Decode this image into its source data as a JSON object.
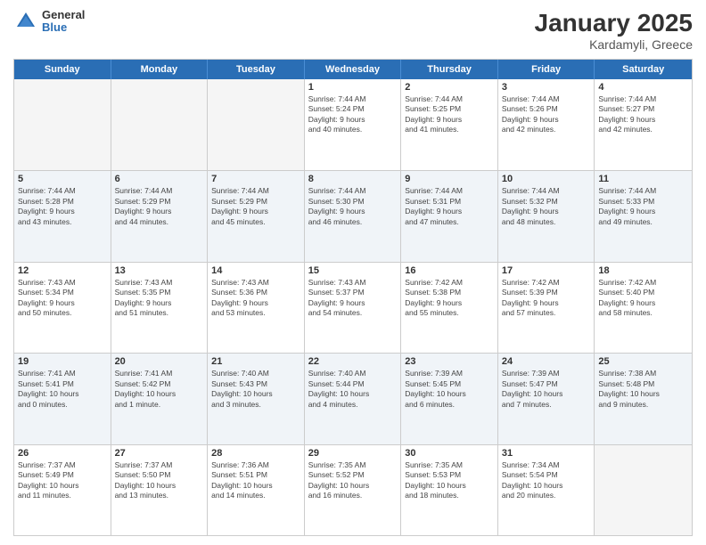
{
  "logo": {
    "general": "General",
    "blue": "Blue"
  },
  "title": "January 2025",
  "location": "Kardamyli, Greece",
  "header_days": [
    "Sunday",
    "Monday",
    "Tuesday",
    "Wednesday",
    "Thursday",
    "Friday",
    "Saturday"
  ],
  "weeks": [
    {
      "alt": false,
      "days": [
        {
          "num": "",
          "empty": true,
          "lines": []
        },
        {
          "num": "",
          "empty": true,
          "lines": []
        },
        {
          "num": "",
          "empty": true,
          "lines": []
        },
        {
          "num": "1",
          "empty": false,
          "lines": [
            "Sunrise: 7:44 AM",
            "Sunset: 5:24 PM",
            "Daylight: 9 hours",
            "and 40 minutes."
          ]
        },
        {
          "num": "2",
          "empty": false,
          "lines": [
            "Sunrise: 7:44 AM",
            "Sunset: 5:25 PM",
            "Daylight: 9 hours",
            "and 41 minutes."
          ]
        },
        {
          "num": "3",
          "empty": false,
          "lines": [
            "Sunrise: 7:44 AM",
            "Sunset: 5:26 PM",
            "Daylight: 9 hours",
            "and 42 minutes."
          ]
        },
        {
          "num": "4",
          "empty": false,
          "lines": [
            "Sunrise: 7:44 AM",
            "Sunset: 5:27 PM",
            "Daylight: 9 hours",
            "and 42 minutes."
          ]
        }
      ]
    },
    {
      "alt": true,
      "days": [
        {
          "num": "5",
          "empty": false,
          "lines": [
            "Sunrise: 7:44 AM",
            "Sunset: 5:28 PM",
            "Daylight: 9 hours",
            "and 43 minutes."
          ]
        },
        {
          "num": "6",
          "empty": false,
          "lines": [
            "Sunrise: 7:44 AM",
            "Sunset: 5:29 PM",
            "Daylight: 9 hours",
            "and 44 minutes."
          ]
        },
        {
          "num": "7",
          "empty": false,
          "lines": [
            "Sunrise: 7:44 AM",
            "Sunset: 5:29 PM",
            "Daylight: 9 hours",
            "and 45 minutes."
          ]
        },
        {
          "num": "8",
          "empty": false,
          "lines": [
            "Sunrise: 7:44 AM",
            "Sunset: 5:30 PM",
            "Daylight: 9 hours",
            "and 46 minutes."
          ]
        },
        {
          "num": "9",
          "empty": false,
          "lines": [
            "Sunrise: 7:44 AM",
            "Sunset: 5:31 PM",
            "Daylight: 9 hours",
            "and 47 minutes."
          ]
        },
        {
          "num": "10",
          "empty": false,
          "lines": [
            "Sunrise: 7:44 AM",
            "Sunset: 5:32 PM",
            "Daylight: 9 hours",
            "and 48 minutes."
          ]
        },
        {
          "num": "11",
          "empty": false,
          "lines": [
            "Sunrise: 7:44 AM",
            "Sunset: 5:33 PM",
            "Daylight: 9 hours",
            "and 49 minutes."
          ]
        }
      ]
    },
    {
      "alt": false,
      "days": [
        {
          "num": "12",
          "empty": false,
          "lines": [
            "Sunrise: 7:43 AM",
            "Sunset: 5:34 PM",
            "Daylight: 9 hours",
            "and 50 minutes."
          ]
        },
        {
          "num": "13",
          "empty": false,
          "lines": [
            "Sunrise: 7:43 AM",
            "Sunset: 5:35 PM",
            "Daylight: 9 hours",
            "and 51 minutes."
          ]
        },
        {
          "num": "14",
          "empty": false,
          "lines": [
            "Sunrise: 7:43 AM",
            "Sunset: 5:36 PM",
            "Daylight: 9 hours",
            "and 53 minutes."
          ]
        },
        {
          "num": "15",
          "empty": false,
          "lines": [
            "Sunrise: 7:43 AM",
            "Sunset: 5:37 PM",
            "Daylight: 9 hours",
            "and 54 minutes."
          ]
        },
        {
          "num": "16",
          "empty": false,
          "lines": [
            "Sunrise: 7:42 AM",
            "Sunset: 5:38 PM",
            "Daylight: 9 hours",
            "and 55 minutes."
          ]
        },
        {
          "num": "17",
          "empty": false,
          "lines": [
            "Sunrise: 7:42 AM",
            "Sunset: 5:39 PM",
            "Daylight: 9 hours",
            "and 57 minutes."
          ]
        },
        {
          "num": "18",
          "empty": false,
          "lines": [
            "Sunrise: 7:42 AM",
            "Sunset: 5:40 PM",
            "Daylight: 9 hours",
            "and 58 minutes."
          ]
        }
      ]
    },
    {
      "alt": true,
      "days": [
        {
          "num": "19",
          "empty": false,
          "lines": [
            "Sunrise: 7:41 AM",
            "Sunset: 5:41 PM",
            "Daylight: 10 hours",
            "and 0 minutes."
          ]
        },
        {
          "num": "20",
          "empty": false,
          "lines": [
            "Sunrise: 7:41 AM",
            "Sunset: 5:42 PM",
            "Daylight: 10 hours",
            "and 1 minute."
          ]
        },
        {
          "num": "21",
          "empty": false,
          "lines": [
            "Sunrise: 7:40 AM",
            "Sunset: 5:43 PM",
            "Daylight: 10 hours",
            "and 3 minutes."
          ]
        },
        {
          "num": "22",
          "empty": false,
          "lines": [
            "Sunrise: 7:40 AM",
            "Sunset: 5:44 PM",
            "Daylight: 10 hours",
            "and 4 minutes."
          ]
        },
        {
          "num": "23",
          "empty": false,
          "lines": [
            "Sunrise: 7:39 AM",
            "Sunset: 5:45 PM",
            "Daylight: 10 hours",
            "and 6 minutes."
          ]
        },
        {
          "num": "24",
          "empty": false,
          "lines": [
            "Sunrise: 7:39 AM",
            "Sunset: 5:47 PM",
            "Daylight: 10 hours",
            "and 7 minutes."
          ]
        },
        {
          "num": "25",
          "empty": false,
          "lines": [
            "Sunrise: 7:38 AM",
            "Sunset: 5:48 PM",
            "Daylight: 10 hours",
            "and 9 minutes."
          ]
        }
      ]
    },
    {
      "alt": false,
      "days": [
        {
          "num": "26",
          "empty": false,
          "lines": [
            "Sunrise: 7:37 AM",
            "Sunset: 5:49 PM",
            "Daylight: 10 hours",
            "and 11 minutes."
          ]
        },
        {
          "num": "27",
          "empty": false,
          "lines": [
            "Sunrise: 7:37 AM",
            "Sunset: 5:50 PM",
            "Daylight: 10 hours",
            "and 13 minutes."
          ]
        },
        {
          "num": "28",
          "empty": false,
          "lines": [
            "Sunrise: 7:36 AM",
            "Sunset: 5:51 PM",
            "Daylight: 10 hours",
            "and 14 minutes."
          ]
        },
        {
          "num": "29",
          "empty": false,
          "lines": [
            "Sunrise: 7:35 AM",
            "Sunset: 5:52 PM",
            "Daylight: 10 hours",
            "and 16 minutes."
          ]
        },
        {
          "num": "30",
          "empty": false,
          "lines": [
            "Sunrise: 7:35 AM",
            "Sunset: 5:53 PM",
            "Daylight: 10 hours",
            "and 18 minutes."
          ]
        },
        {
          "num": "31",
          "empty": false,
          "lines": [
            "Sunrise: 7:34 AM",
            "Sunset: 5:54 PM",
            "Daylight: 10 hours",
            "and 20 minutes."
          ]
        },
        {
          "num": "",
          "empty": true,
          "lines": []
        }
      ]
    }
  ]
}
